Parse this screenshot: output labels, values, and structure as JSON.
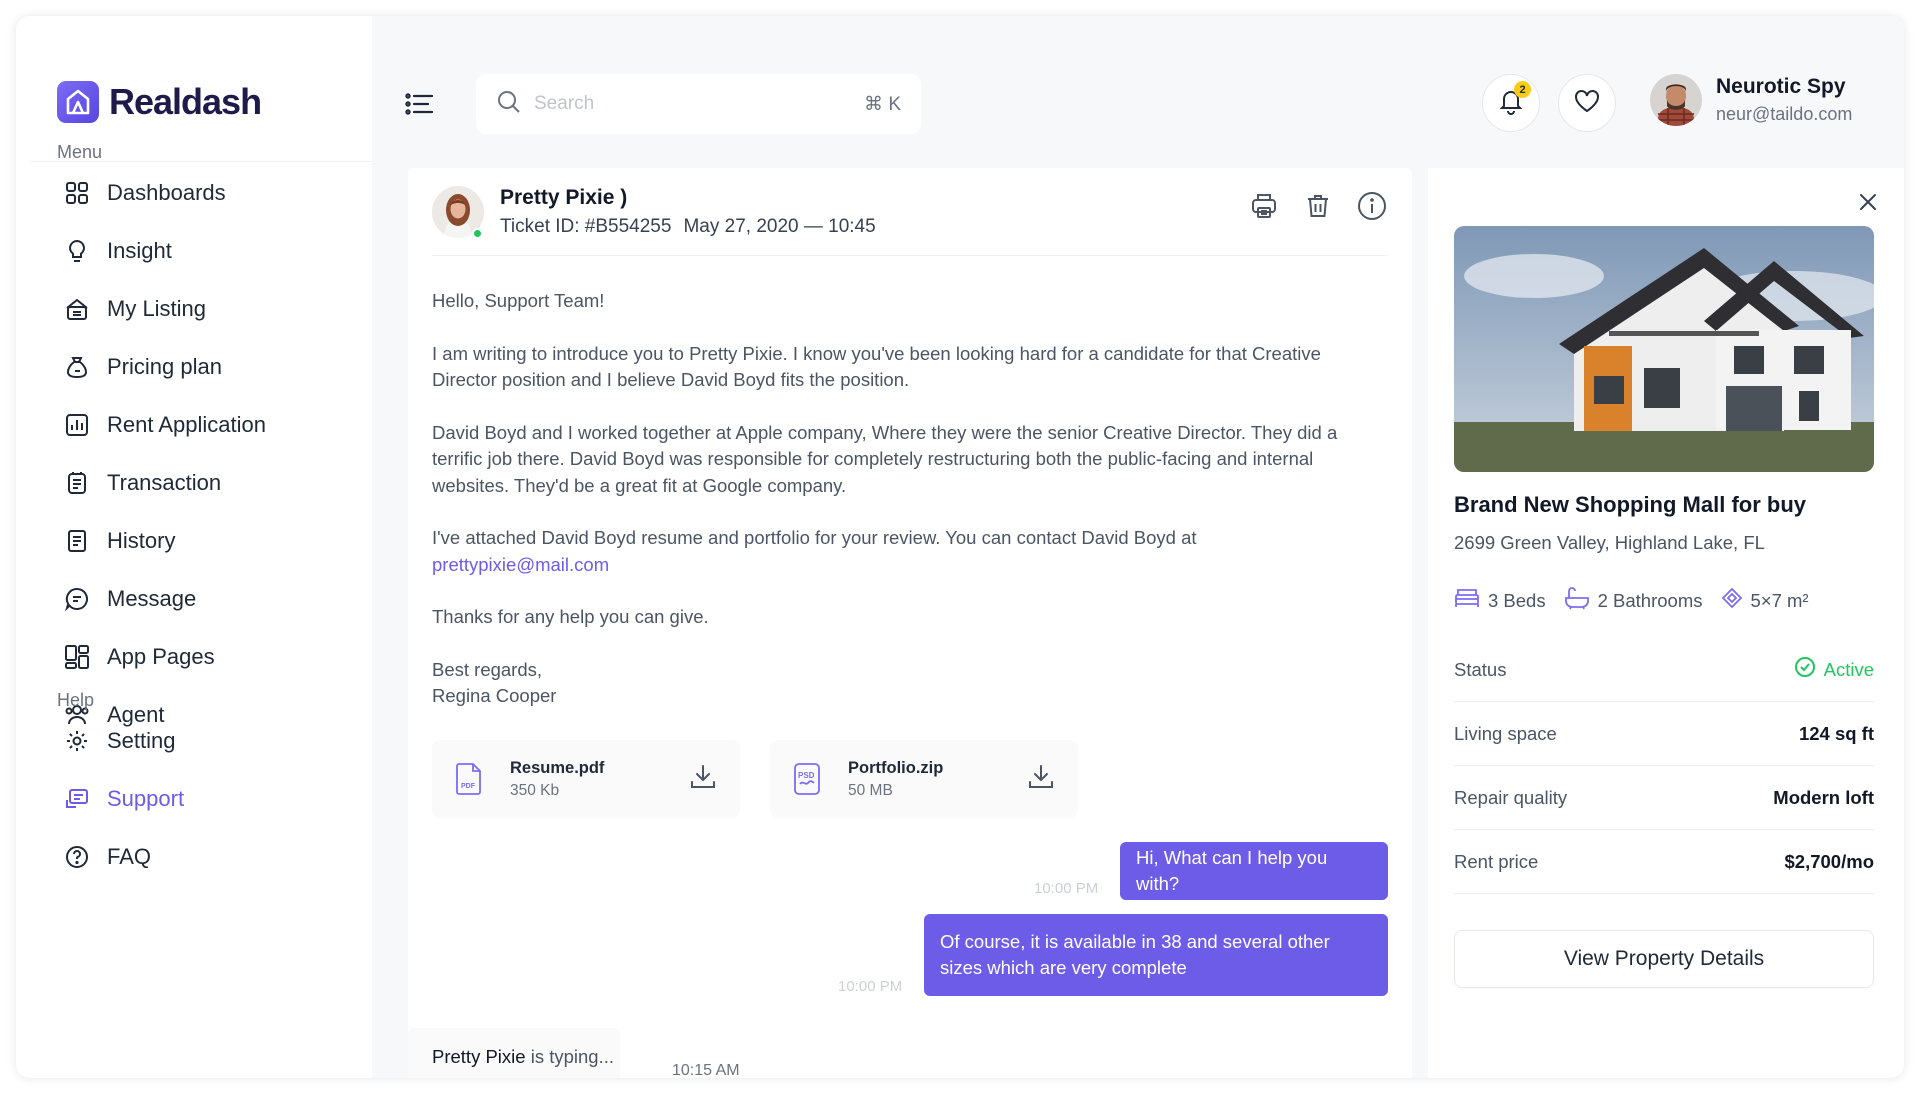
{
  "brand": {
    "name": "Realdash"
  },
  "sidebar": {
    "menu_label": "Menu",
    "help_label": "Help",
    "menu_items": [
      {
        "label": "Dashboards",
        "icon": "grid-icon"
      },
      {
        "label": "Insight",
        "icon": "lightbulb-icon"
      },
      {
        "label": "My Listing",
        "icon": "house-icon"
      },
      {
        "label": "Pricing plan",
        "icon": "money-bag-icon"
      },
      {
        "label": "Rent Application",
        "icon": "bar-chart-icon"
      },
      {
        "label": "Transaction",
        "icon": "receipt-icon"
      },
      {
        "label": "History",
        "icon": "document-icon"
      },
      {
        "label": "Message",
        "icon": "chat-icon"
      },
      {
        "label": "App Pages",
        "icon": "layout-icon"
      },
      {
        "label": "Agent",
        "icon": "users-icon"
      }
    ],
    "help_items": [
      {
        "label": "Setting",
        "icon": "gear-icon"
      },
      {
        "label": "Support",
        "icon": "support-icon",
        "active": true
      },
      {
        "label": "FAQ",
        "icon": "question-icon"
      }
    ]
  },
  "header": {
    "search_placeholder": "Search",
    "search_shortcut": "⌘ K",
    "notification_count": "2",
    "user": {
      "name": "Neurotic Spy",
      "email": "neur@taildo.com"
    }
  },
  "email": {
    "sender_name": "Pretty Pixie )",
    "ticket_id": "Ticket ID: #B554255",
    "date": "May 27, 2020 — 10:45",
    "greeting": "Hello, Support Team!",
    "para1": "I am writing to introduce you to  Pretty Pixie. I know you've been looking hard for a candidate for that Creative Director position and I believe David Boyd fits the position.",
    "para2": "David Boyd and I worked together at Apple company, Where they were the senior Creative Director. They did a terrific job there. David Boyd was responsible for completely restructuring both the public-facing and internal websites. They'd be a great fit at Google company.",
    "para3": "I've attached David Boyd resume and portfolio for your review. You can contact David Boyd at",
    "contact_email": "prettypixie@mail.com",
    "thanks": "Thanks for any help you can give.",
    "signoff": "Best regards,",
    "signature": "Regina Cooper",
    "attachments": [
      {
        "name": "Resume.pdf",
        "size": "350 Kb",
        "type": "PDF"
      },
      {
        "name": "Portfolio.zip",
        "size": "50 MB",
        "type": "PSD"
      }
    ]
  },
  "chat": {
    "messages": [
      {
        "text": "Hi, What can I help you with?",
        "time": "10:00 PM"
      },
      {
        "text": "Of course, it is available in 38 and several other sizes which are very complete",
        "time": "10:00 PM"
      }
    ],
    "typing_name": "Pretty Pixie",
    "typing_text": " is typing...",
    "typing_time": "10:15 AM"
  },
  "property": {
    "title": "Brand New Shopping Mall for buy",
    "address": "2699 Green Valley, Highland Lake, FL",
    "beds": "3 Beds",
    "baths": "2 Bathrooms",
    "area": "5×7 m²",
    "rows": [
      {
        "label": "Status",
        "value": "Active"
      },
      {
        "label": "Living space",
        "value": "124 sq ft"
      },
      {
        "label": "Repair quality",
        "value": "Modern loft"
      },
      {
        "label": "Rent price",
        "value": "$2,700/mo"
      }
    ],
    "button": "View Property Details"
  },
  "colors": {
    "accent": "#6d5ce8",
    "active": "#22c55e",
    "badge": "#facc15"
  }
}
